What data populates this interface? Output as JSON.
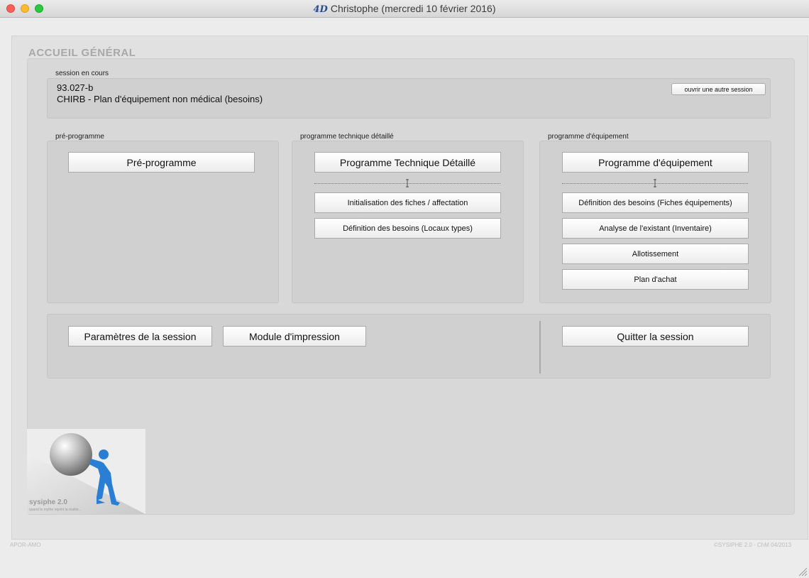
{
  "window": {
    "title": "Christophe (mercredi 10 février 2016)",
    "logo": "4D"
  },
  "heading": "ACCUEIL GÉNÉRAL",
  "session": {
    "label": "session en cours",
    "code": "93.027-b",
    "name": "CHIRB - Plan d'équipement non médical (besoins)",
    "open_other_button": "ouvrir une autre session"
  },
  "pre_programme": {
    "label": "pré-programme",
    "main_button": "Pré-programme"
  },
  "programme_technique": {
    "label": "programme technique détaillé",
    "main_button": "Programme Technique Détaillé",
    "buttons": [
      "Initialisation des fiches / affectation",
      "Définition des besoins (Locaux types)"
    ]
  },
  "programme_equipement": {
    "label": "programme d'équipement",
    "main_button": "Programme d'équipement",
    "buttons": [
      "Définition des besoins (Fiches équipements)",
      "Analyse de l'existant (Inventaire)",
      "Allotissement",
      "Plan d'achat"
    ]
  },
  "bottom": {
    "params_button": "Paramètres de la session",
    "print_button": "Module d'impression",
    "quit_button": "Quitter la session"
  },
  "logo": {
    "title": "sysiphe 2.0",
    "tagline": "quand le mythe rejoint la réalité..."
  },
  "footer": {
    "left": "APOR-AMO",
    "right": "©SYSIPHE 2.0 - ChM 04/2013"
  }
}
